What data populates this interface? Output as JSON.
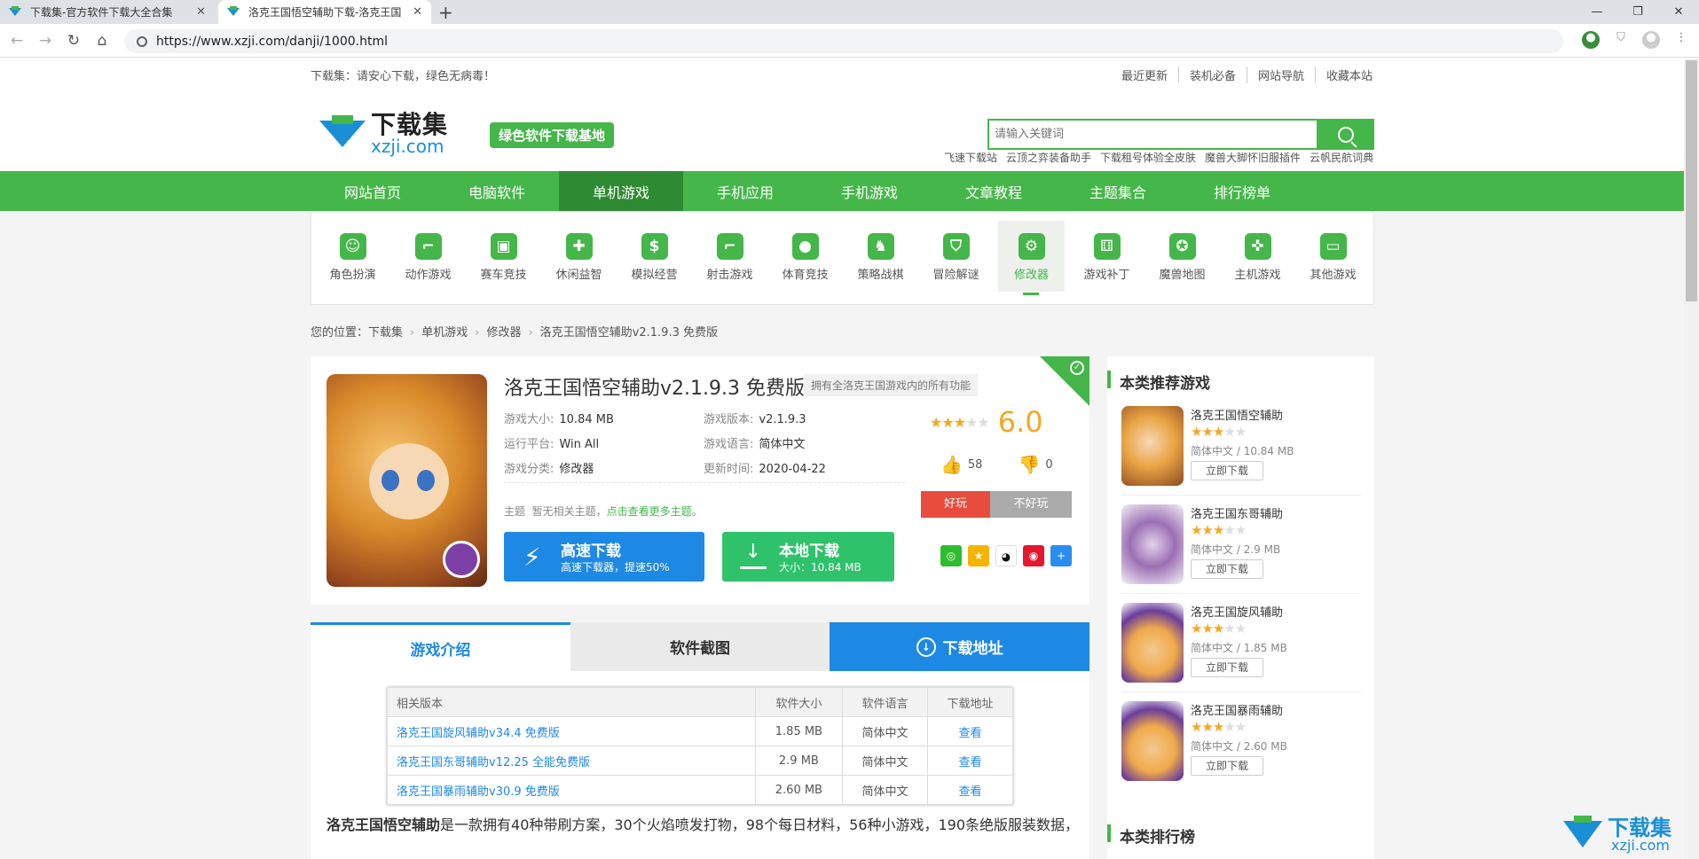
{
  "browser": {
    "tabs": [
      {
        "title": "下载集-官方软件下载大全合集"
      },
      {
        "title": "洛克王国悟空辅助下载-洛克王国"
      }
    ],
    "url": "https://www.xzji.com/danji/1000.html"
  },
  "site": {
    "notice": "下载集：请安心下载，绿色无病毒！",
    "top_links": [
      "最近更新",
      "装机必备",
      "网站导航",
      "收藏本站"
    ],
    "logo_cn": "下载集",
    "logo_en": "xzji.com",
    "slogan": "绿色软件下载基地",
    "search_placeholder": "请输入关键词",
    "hot_words": [
      "飞速下载站",
      "云顶之弈装备助手",
      "下载租号体验全皮肤",
      "魔兽大脚怀旧服插件",
      "云帆民航词典"
    ],
    "nav": [
      "网站首页",
      "电脑软件",
      "单机游戏",
      "手机应用",
      "手机游戏",
      "文章教程",
      "主题集合",
      "排行榜单"
    ],
    "nav_active": "单机游戏"
  },
  "categories": [
    {
      "label": "角色扮演",
      "icon": "mask-icon"
    },
    {
      "label": "动作游戏",
      "icon": "gun-icon"
    },
    {
      "label": "赛车竞技",
      "icon": "car-icon"
    },
    {
      "label": "休闲益智",
      "icon": "puzzle-icon"
    },
    {
      "label": "模拟经营",
      "icon": "money-bag-icon"
    },
    {
      "label": "射击游戏",
      "icon": "pistol-icon"
    },
    {
      "label": "体育竞技",
      "icon": "ball-icon"
    },
    {
      "label": "策略战棋",
      "icon": "chess-knight-icon"
    },
    {
      "label": "冒险解谜",
      "icon": "shield-icon"
    },
    {
      "label": "修改器",
      "icon": "gear-icon"
    },
    {
      "label": "游戏补丁",
      "icon": "dice-icon"
    },
    {
      "label": "魔兽地图",
      "icon": "medal-icon"
    },
    {
      "label": "主机游戏",
      "icon": "gamepad-icon"
    },
    {
      "label": "其他游戏",
      "icon": "monitor-icon"
    }
  ],
  "breadcrumb": {
    "prefix": "您的位置：",
    "items": [
      "下载集",
      "单机游戏",
      "修改器",
      "洛克王国悟空辅助v2.1.9.3 免费版"
    ]
  },
  "game": {
    "title": "洛克王国悟空辅助v2.1.9.3 免费版",
    "tag": "拥有全洛克王国游戏内的所有功能",
    "size_label": "游戏大小:",
    "size": "10.84 MB",
    "version_label": "游戏版本:",
    "version": "v2.1.9.3",
    "platform_label": "运行平台:",
    "platform": "Win All",
    "language_label": "游戏语言:",
    "language": "简体中文",
    "category_label": "游戏分类:",
    "category": "修改器",
    "updated_label": "更新时间:",
    "updated": "2020-04-22",
    "theme_label": "主题",
    "theme_text": "暂无相关主题，",
    "theme_link": "点击查看更多主题",
    "theme_end": "。",
    "rating_stars": 3,
    "score": "6.0",
    "likes": "58",
    "dislikes": "0",
    "vote_good": "好玩",
    "vote_bad": "不好玩",
    "fast_dl_title": "高速下载",
    "fast_dl_sub": "高速下载器，提速50%",
    "local_dl_title": "本地下载",
    "local_dl_sub": "大小：10.84 MB",
    "share_icons": [
      "wechat-icon",
      "qzone-icon",
      "qq-icon",
      "weibo-icon",
      "more-share-icon"
    ]
  },
  "detail_tabs": [
    "游戏介绍",
    "软件截图",
    "下载地址"
  ],
  "versions_table": {
    "headers": [
      "相关版本",
      "软件大小",
      "软件语言",
      "下载地址"
    ],
    "rows": [
      [
        "洛克王国旋风辅助v34.4 免费版",
        "1.85 MB",
        "简体中文",
        "查看"
      ],
      [
        "洛克王国东哥辅助v12.25 全能免费版",
        "2.9 MB",
        "简体中文",
        "查看"
      ],
      [
        "洛克王国暴雨辅助v30.9 免费版",
        "2.60 MB",
        "简体中文",
        "查看"
      ]
    ]
  },
  "intro": {
    "bold": "洛克王国悟空辅助",
    "text": "是一款拥有40种带刷方案，30个火焰喷发打物，98个每日材料，56种小游戏，190条绝版服装数据，"
  },
  "sidebar": {
    "title": "本类推荐游戏",
    "items": [
      {
        "name": "洛克王国悟空辅助",
        "stars": 3,
        "lang": "简体中文",
        "size": "10.84 MB",
        "btn": "立即下载"
      },
      {
        "name": "洛克王国东哥辅助",
        "stars": 3,
        "lang": "简体中文",
        "size": "2.9 MB",
        "btn": "立即下载"
      },
      {
        "name": "洛克王国旋风辅助",
        "stars": 3,
        "lang": "简体中文",
        "size": "1.85 MB",
        "btn": "立即下载"
      },
      {
        "name": "洛克王国暴雨辅助",
        "stars": 3,
        "lang": "简体中文",
        "size": "2.60 MB",
        "btn": "立即下载"
      }
    ],
    "rank_title": "本类排行榜"
  },
  "watermark": {
    "cn": "下载集",
    "en": "xzji.com"
  },
  "colors": {
    "brand_green": "#45b649",
    "brand_blue": "#1e88e5",
    "star": "#f5a623"
  }
}
